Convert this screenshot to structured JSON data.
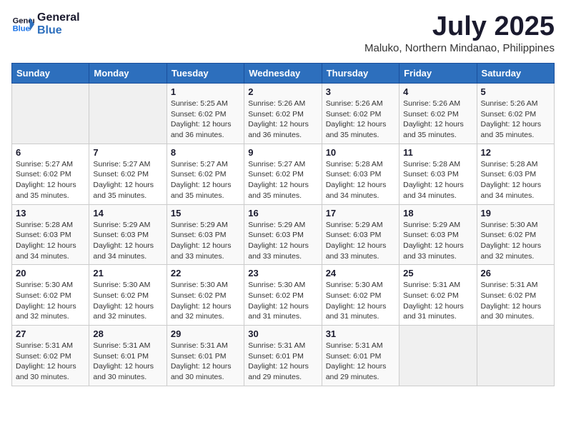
{
  "logo": {
    "text_general": "General",
    "text_blue": "Blue"
  },
  "title": "July 2025",
  "subtitle": "Maluko, Northern Mindanao, Philippines",
  "weekdays": [
    "Sunday",
    "Monday",
    "Tuesday",
    "Wednesday",
    "Thursday",
    "Friday",
    "Saturday"
  ],
  "weeks": [
    [
      {
        "day": "",
        "info": ""
      },
      {
        "day": "",
        "info": ""
      },
      {
        "day": "1",
        "info": "Sunrise: 5:25 AM\nSunset: 6:02 PM\nDaylight: 12 hours and 36 minutes."
      },
      {
        "day": "2",
        "info": "Sunrise: 5:26 AM\nSunset: 6:02 PM\nDaylight: 12 hours and 36 minutes."
      },
      {
        "day": "3",
        "info": "Sunrise: 5:26 AM\nSunset: 6:02 PM\nDaylight: 12 hours and 35 minutes."
      },
      {
        "day": "4",
        "info": "Sunrise: 5:26 AM\nSunset: 6:02 PM\nDaylight: 12 hours and 35 minutes."
      },
      {
        "day": "5",
        "info": "Sunrise: 5:26 AM\nSunset: 6:02 PM\nDaylight: 12 hours and 35 minutes."
      }
    ],
    [
      {
        "day": "6",
        "info": "Sunrise: 5:27 AM\nSunset: 6:02 PM\nDaylight: 12 hours and 35 minutes."
      },
      {
        "day": "7",
        "info": "Sunrise: 5:27 AM\nSunset: 6:02 PM\nDaylight: 12 hours and 35 minutes."
      },
      {
        "day": "8",
        "info": "Sunrise: 5:27 AM\nSunset: 6:02 PM\nDaylight: 12 hours and 35 minutes."
      },
      {
        "day": "9",
        "info": "Sunrise: 5:27 AM\nSunset: 6:02 PM\nDaylight: 12 hours and 35 minutes."
      },
      {
        "day": "10",
        "info": "Sunrise: 5:28 AM\nSunset: 6:03 PM\nDaylight: 12 hours and 34 minutes."
      },
      {
        "day": "11",
        "info": "Sunrise: 5:28 AM\nSunset: 6:03 PM\nDaylight: 12 hours and 34 minutes."
      },
      {
        "day": "12",
        "info": "Sunrise: 5:28 AM\nSunset: 6:03 PM\nDaylight: 12 hours and 34 minutes."
      }
    ],
    [
      {
        "day": "13",
        "info": "Sunrise: 5:28 AM\nSunset: 6:03 PM\nDaylight: 12 hours and 34 minutes."
      },
      {
        "day": "14",
        "info": "Sunrise: 5:29 AM\nSunset: 6:03 PM\nDaylight: 12 hours and 34 minutes."
      },
      {
        "day": "15",
        "info": "Sunrise: 5:29 AM\nSunset: 6:03 PM\nDaylight: 12 hours and 33 minutes."
      },
      {
        "day": "16",
        "info": "Sunrise: 5:29 AM\nSunset: 6:03 PM\nDaylight: 12 hours and 33 minutes."
      },
      {
        "day": "17",
        "info": "Sunrise: 5:29 AM\nSunset: 6:03 PM\nDaylight: 12 hours and 33 minutes."
      },
      {
        "day": "18",
        "info": "Sunrise: 5:29 AM\nSunset: 6:03 PM\nDaylight: 12 hours and 33 minutes."
      },
      {
        "day": "19",
        "info": "Sunrise: 5:30 AM\nSunset: 6:02 PM\nDaylight: 12 hours and 32 minutes."
      }
    ],
    [
      {
        "day": "20",
        "info": "Sunrise: 5:30 AM\nSunset: 6:02 PM\nDaylight: 12 hours and 32 minutes."
      },
      {
        "day": "21",
        "info": "Sunrise: 5:30 AM\nSunset: 6:02 PM\nDaylight: 12 hours and 32 minutes."
      },
      {
        "day": "22",
        "info": "Sunrise: 5:30 AM\nSunset: 6:02 PM\nDaylight: 12 hours and 32 minutes."
      },
      {
        "day": "23",
        "info": "Sunrise: 5:30 AM\nSunset: 6:02 PM\nDaylight: 12 hours and 31 minutes."
      },
      {
        "day": "24",
        "info": "Sunrise: 5:30 AM\nSunset: 6:02 PM\nDaylight: 12 hours and 31 minutes."
      },
      {
        "day": "25",
        "info": "Sunrise: 5:31 AM\nSunset: 6:02 PM\nDaylight: 12 hours and 31 minutes."
      },
      {
        "day": "26",
        "info": "Sunrise: 5:31 AM\nSunset: 6:02 PM\nDaylight: 12 hours and 30 minutes."
      }
    ],
    [
      {
        "day": "27",
        "info": "Sunrise: 5:31 AM\nSunset: 6:02 PM\nDaylight: 12 hours and 30 minutes."
      },
      {
        "day": "28",
        "info": "Sunrise: 5:31 AM\nSunset: 6:01 PM\nDaylight: 12 hours and 30 minutes."
      },
      {
        "day": "29",
        "info": "Sunrise: 5:31 AM\nSunset: 6:01 PM\nDaylight: 12 hours and 30 minutes."
      },
      {
        "day": "30",
        "info": "Sunrise: 5:31 AM\nSunset: 6:01 PM\nDaylight: 12 hours and 29 minutes."
      },
      {
        "day": "31",
        "info": "Sunrise: 5:31 AM\nSunset: 6:01 PM\nDaylight: 12 hours and 29 minutes."
      },
      {
        "day": "",
        "info": ""
      },
      {
        "day": "",
        "info": ""
      }
    ]
  ]
}
